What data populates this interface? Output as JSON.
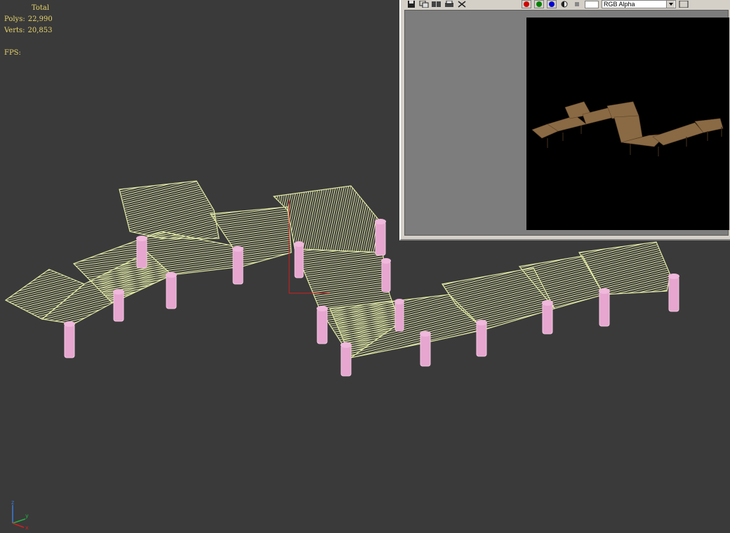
{
  "viewport": {
    "stats": {
      "title": "Total",
      "polys_label": "Polys:",
      "polys_value": "22,990",
      "verts_label": "Verts:",
      "verts_value": "20,853",
      "fps_label": "FPS:",
      "fps_value": ""
    },
    "axis": {
      "x": "x",
      "y": "y",
      "z": "z"
    },
    "colors": {
      "background": "#3a3a3a",
      "wireframe": "#e3eaa6",
      "posts": "#e6a6cf",
      "stats_text": "#e8d46a"
    }
  },
  "render_window": {
    "toolbar_icons": [
      "save-icon",
      "copy-icon",
      "clone-icon",
      "print-icon",
      "clear-icon"
    ],
    "channels": [
      {
        "name": "red-channel-toggle",
        "color": "#d00000"
      },
      {
        "name": "green-channel-toggle",
        "color": "#008000"
      },
      {
        "name": "blue-channel-toggle",
        "color": "#0000d0"
      }
    ],
    "channel_select": "RGB Alpha"
  }
}
